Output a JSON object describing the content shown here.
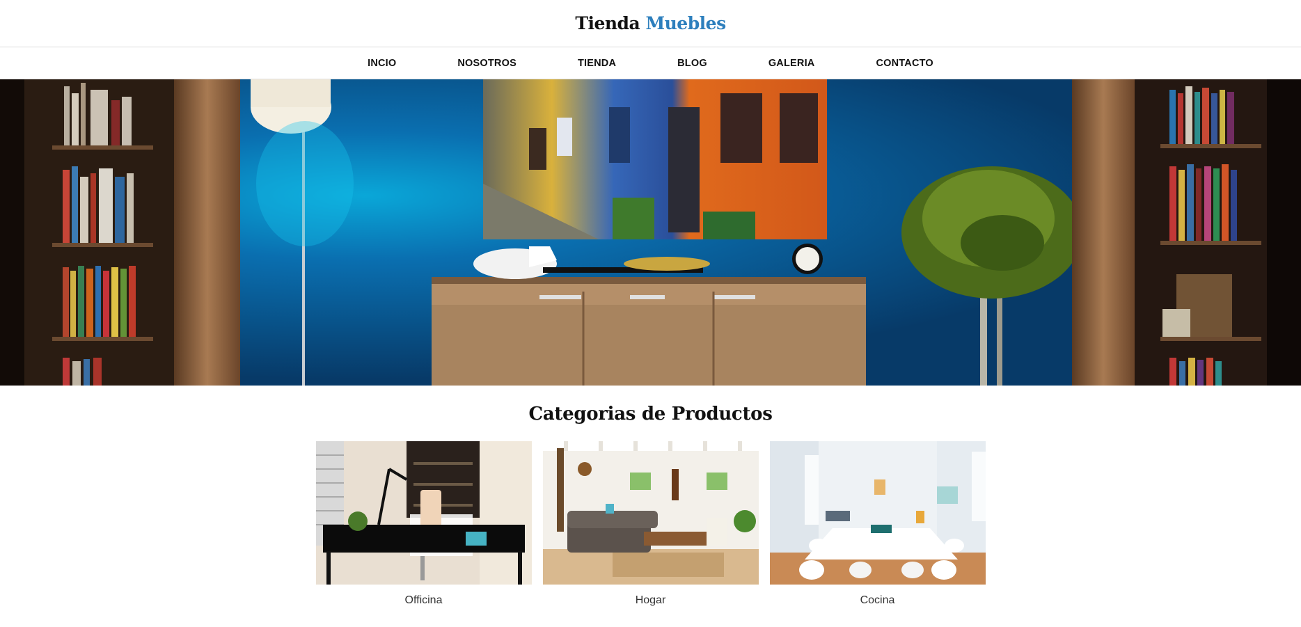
{
  "header": {
    "logo_part1": "Tienda",
    "logo_part2": "Muebles",
    "accent_color": "#2d7fbd"
  },
  "nav": {
    "items": [
      {
        "label": "INCIO"
      },
      {
        "label": "NOSOTROS"
      },
      {
        "label": "TIENDA"
      },
      {
        "label": "BLOG"
      },
      {
        "label": "GALERIA"
      },
      {
        "label": "CONTACTO"
      }
    ]
  },
  "hero": {
    "image_subject": "living-room-blue-wall"
  },
  "categories": {
    "title": "Categorias de Productos",
    "items": [
      {
        "label": "Officina",
        "image_subject": "office-desk"
      },
      {
        "label": "Hogar",
        "image_subject": "living-room-sofa"
      },
      {
        "label": "Cocina",
        "image_subject": "white-dining-room"
      }
    ]
  }
}
